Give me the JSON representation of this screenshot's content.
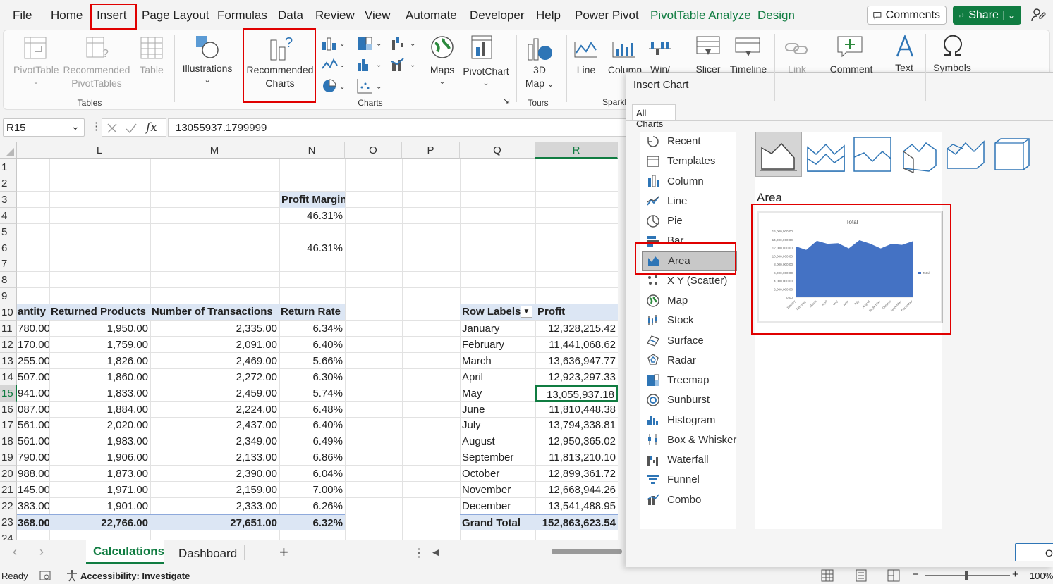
{
  "menu": {
    "tabs": [
      "File",
      "Home",
      "Insert",
      "Page Layout",
      "Formulas",
      "Data",
      "Review",
      "View",
      "Automate",
      "Developer",
      "Help",
      "Power Pivot",
      "PivotTable Analyze",
      "Design"
    ],
    "comments": "Comments",
    "share": "Share"
  },
  "ribbon": {
    "pivottable": "PivotTable",
    "recommended_pivottables_1": "Recommended",
    "recommended_pivottables_2": "PivotTables",
    "table": "Table",
    "group_tables": "Tables",
    "illustrations": "Illustrations",
    "recommended_charts_1": "Recommended",
    "recommended_charts_2": "Charts",
    "maps": "Maps",
    "pivotchart": "PivotChart",
    "group_charts": "Charts",
    "map3d_1": "3D",
    "map3d_2": "Map",
    "group_tours": "Tours",
    "line": "Line",
    "column": "Column",
    "winloss": "Win/",
    "group_sparklines": "Sparkl",
    "slicer": "Slicer",
    "timeline": "Timeline",
    "link": "Link",
    "comment": "Comment",
    "text": "Text",
    "symbols": "Symbols"
  },
  "formula_bar": {
    "name_box": "R15",
    "fx": "fx",
    "value": "13055937.1799999"
  },
  "columns": [
    "L",
    "M",
    "N",
    "O",
    "P",
    "Q",
    "R"
  ],
  "rows": [
    "1",
    "2",
    "3",
    "4",
    "5",
    "6",
    "7",
    "8",
    "9",
    "10",
    "11",
    "12",
    "13",
    "14",
    "15",
    "16",
    "17",
    "18",
    "19",
    "20",
    "21",
    "22",
    "23",
    "24"
  ],
  "profit_margin": {
    "label": "Profit Margin",
    "v1": "46.31%",
    "v2": "46.31%"
  },
  "table_left": {
    "headers": [
      "antity",
      "Returned Products",
      "Number of Transactions",
      "Return Rate"
    ],
    "rows": [
      [
        "780.00",
        "1,950.00",
        "2,335.00",
        "6.34%"
      ],
      [
        "170.00",
        "1,759.00",
        "2,091.00",
        "6.40%"
      ],
      [
        "255.00",
        "1,826.00",
        "2,469.00",
        "5.66%"
      ],
      [
        "507.00",
        "1,860.00",
        "2,272.00",
        "6.30%"
      ],
      [
        "941.00",
        "1,833.00",
        "2,459.00",
        "5.74%"
      ],
      [
        "087.00",
        "1,884.00",
        "2,224.00",
        "6.48%"
      ],
      [
        "561.00",
        "2,020.00",
        "2,437.00",
        "6.40%"
      ],
      [
        "561.00",
        "1,983.00",
        "2,349.00",
        "6.49%"
      ],
      [
        "790.00",
        "1,906.00",
        "2,133.00",
        "6.86%"
      ],
      [
        "988.00",
        "1,873.00",
        "2,390.00",
        "6.04%"
      ],
      [
        "145.00",
        "1,971.00",
        "2,159.00",
        "7.00%"
      ],
      [
        "383.00",
        "1,901.00",
        "2,333.00",
        "6.26%"
      ]
    ],
    "total": [
      "368.00",
      "22,766.00",
      "27,651.00",
      "6.32%"
    ]
  },
  "pivot": {
    "row_labels": "Row Labels",
    "profit": "Profit",
    "rows": [
      [
        "January",
        "12,328,215.42"
      ],
      [
        "February",
        "11,441,068.62"
      ],
      [
        "March",
        "13,636,947.77"
      ],
      [
        "April",
        "12,923,297.33"
      ],
      [
        "May",
        "13,055,937.18"
      ],
      [
        "June",
        "11,810,448.38"
      ],
      [
        "July",
        "13,794,338.81"
      ],
      [
        "August",
        "12,950,365.02"
      ],
      [
        "September",
        "11,813,210.10"
      ],
      [
        "October",
        "12,899,361.72"
      ],
      [
        "November",
        "12,668,944.26"
      ],
      [
        "December",
        "13,541,488.95"
      ]
    ],
    "grand_total_label": "Grand Total",
    "grand_total": "152,863,623.54"
  },
  "sheet_tabs": {
    "calculations": "Calculations",
    "dashboard": "Dashboard",
    "add": "+"
  },
  "status": {
    "ready": "Ready",
    "accessibility": "Accessibility: Investigate",
    "zoom": "100%"
  },
  "dialog": {
    "title": "Insert Chart",
    "tab_all_charts": "All Charts",
    "chart_types": [
      "Recent",
      "Templates",
      "Column",
      "Line",
      "Pie",
      "Bar",
      "Area",
      "X Y (Scatter)",
      "Map",
      "Stock",
      "Surface",
      "Radar",
      "Treemap",
      "Sunburst",
      "Histogram",
      "Box & Whisker",
      "Waterfall",
      "Funnel",
      "Combo"
    ],
    "selected_type": "Area",
    "section_title": "Area",
    "ok": "OK",
    "accent_color": "#4472c4"
  },
  "chart_data": {
    "type": "area",
    "title": "Total",
    "categories": [
      "January",
      "February",
      "March",
      "April",
      "May",
      "June",
      "July",
      "August",
      "September",
      "October",
      "November",
      "December"
    ],
    "series": [
      {
        "name": "Total",
        "values": [
          12328215.42,
          11441068.62,
          13636947.77,
          12923297.33,
          13055937.18,
          11810448.38,
          13794338.81,
          12950365.02,
          11813210.1,
          12899361.72,
          12668944.26,
          13541488.95
        ]
      }
    ],
    "yticks": [
      "16,000,000.00",
      "14,000,000.00",
      "12,000,000.00",
      "10,000,000.00",
      "8,000,000.00",
      "6,000,000.00",
      "4,000,000.00",
      "2,000,000.00",
      "0.00"
    ],
    "ylim": [
      0,
      16000000
    ],
    "legend": "right"
  }
}
